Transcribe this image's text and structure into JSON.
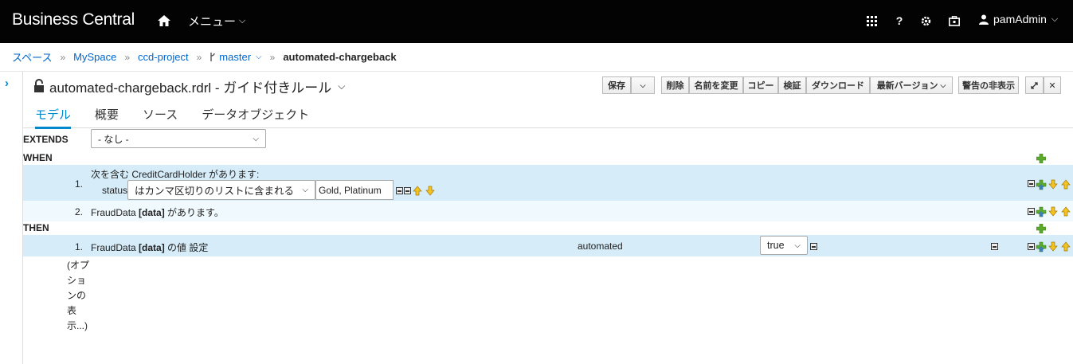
{
  "topbar": {
    "brand": "Business Central",
    "menu_label": "メニュー",
    "user_name": "pamAdmin"
  },
  "breadcrumb": {
    "items": [
      "スペース",
      "MySpace",
      "ccd-project",
      "master",
      "automated-chargeback"
    ]
  },
  "editor": {
    "title": "automated-chargeback.rdrl - ガイド付きルール",
    "buttons": {
      "save": "保存",
      "delete": "削除",
      "rename": "名前を変更",
      "copy": "コピー",
      "validate": "検証",
      "download": "ダウンロード",
      "latest_version": "最新バージョン",
      "hide_alerts": "警告の非表示"
    },
    "tabs": [
      "モデル",
      "概要",
      "ソース",
      "データオブジェクト"
    ]
  },
  "rule": {
    "extends_label": "EXTENDS",
    "extends_value": "- なし -",
    "when_label": "WHEN",
    "then_label": "THEN",
    "when_rows": [
      {
        "num": "1.",
        "header": "次を含む CreditCardHolder があります:",
        "field": "status",
        "operator": "はカンマ区切りのリストに含まれる",
        "value": "Gold, Platinum"
      },
      {
        "num": "2.",
        "text_pre": "FraudData ",
        "text_bold": "[data]",
        "text_post": " があります。"
      }
    ],
    "then_rows": [
      {
        "num": "1.",
        "text_pre": "FraudData ",
        "text_bold": "[data]",
        "text_post": " の値 設定",
        "field": "automated",
        "value": "true"
      }
    ],
    "options_text": "(オプションの表示...)"
  },
  "colors": {
    "accent": "#0088ce",
    "row_blue": "#d6ecf9",
    "row_light": "#f0f9fd",
    "topbar": "#030303"
  }
}
